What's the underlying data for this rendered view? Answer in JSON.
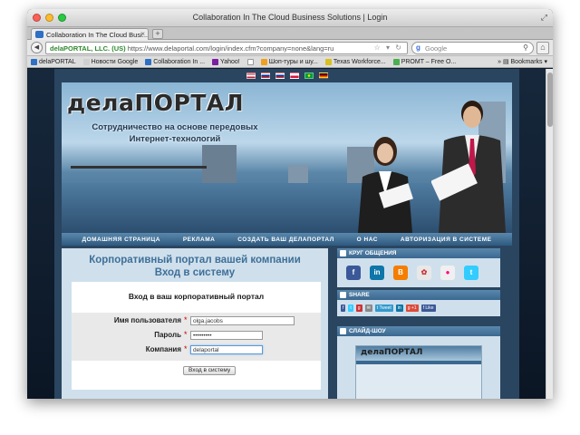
{
  "window": {
    "title": "Collaboration In The Cloud Business Solutions | Login"
  },
  "tab": {
    "label": "Collaboration In The Cloud Busi..."
  },
  "urlbar": {
    "site": "delaPORTAL, LLC. (US)",
    "url": "https://www.delaportal.com/login/index.cfm?company=none&lang=ru"
  },
  "search": {
    "placeholder": "Google"
  },
  "bookmarks": {
    "items": [
      "delaPORTAL",
      "Новости Google",
      "Collaboration In ...",
      "Yahoo!",
      "Шоп-туры и шу...",
      "Texas Workforce...",
      "PROMT – Free O..."
    ],
    "bookmarks_label": "Bookmarks"
  },
  "banner": {
    "logo": "делаПОРТАЛ",
    "tagline": "Сотрудничество на основе передовых Интернет-технологий"
  },
  "nav": {
    "items": [
      "ДОМАШНЯЯ СТРАНИЦА",
      "РЕКЛАМА",
      "СОЗДАТЬ ВАШ ДЕЛАПОРТАЛ",
      "О НАС",
      "АВТОРИЗАЦИЯ В СИСТЕМЕ"
    ]
  },
  "main": {
    "title_line1": "Корпоративный портал вашей компании",
    "title_line2": "Вход в систему",
    "login_heading": "Вход в ваш корпоративный портал",
    "username_label": "Имя пользователя",
    "username_value": "olga.jacobs",
    "password_label": "Пароль",
    "password_value": "•••••••••",
    "company_label": "Компания",
    "company_value": "delaportal",
    "submit_label": "Вход в систему",
    "required_mark": "*"
  },
  "sidebar": {
    "social_title": "КРУГ ОБЩЕНИЯ",
    "share_title": "SHARE",
    "slideshow_title": "СЛАЙД-ШОУ",
    "slide_logo": "делаПОРТАЛ",
    "share_tweet": "Tweet",
    "share_plus": "+1",
    "share_like": "Like"
  },
  "colors": {
    "accent": "#3f6f98",
    "nav_bg": "#2f5a80",
    "page_bg": "#2a4560"
  }
}
